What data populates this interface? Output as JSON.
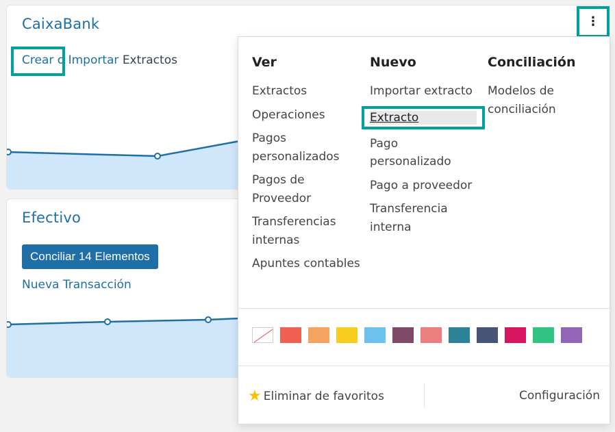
{
  "cards": [
    {
      "title": "CaixaBank",
      "actions": {
        "create": "Crear",
        "separator": "o",
        "import": "Importar",
        "suffix": "Extractos"
      }
    },
    {
      "title": "Efectivo",
      "reconcile_button": "Conciliar 14 Elementos",
      "new_transaction": "Nueva Transacción"
    }
  ],
  "menu": {
    "ver": {
      "heading": "Ver",
      "items": [
        "Extractos",
        "Operaciones",
        "Pagos personalizados",
        "Pagos de Proveedor",
        "Transferencias internas",
        "Apuntes contables"
      ]
    },
    "nuevo": {
      "heading": "Nuevo",
      "items": [
        "Importar extracto",
        "Extracto",
        "Pago personalizado",
        "Pago a proveedor",
        "Transferencia interna"
      ]
    },
    "conciliacion": {
      "heading": "Conciliación",
      "items": [
        "Modelos de conciliación"
      ]
    },
    "colors": [
      "none",
      "#f06050",
      "#f4a460",
      "#f7cd1f",
      "#6cc1ed",
      "#814968",
      "#eb7e7f",
      "#2c8397",
      "#475577",
      "#d6145f",
      "#30c381",
      "#9365b8"
    ],
    "footer": {
      "favorite": "Eliminar de favoritos",
      "settings": "Configuración"
    }
  },
  "icons": {
    "kebab": "kebab-menu-icon",
    "star": "star-icon"
  }
}
